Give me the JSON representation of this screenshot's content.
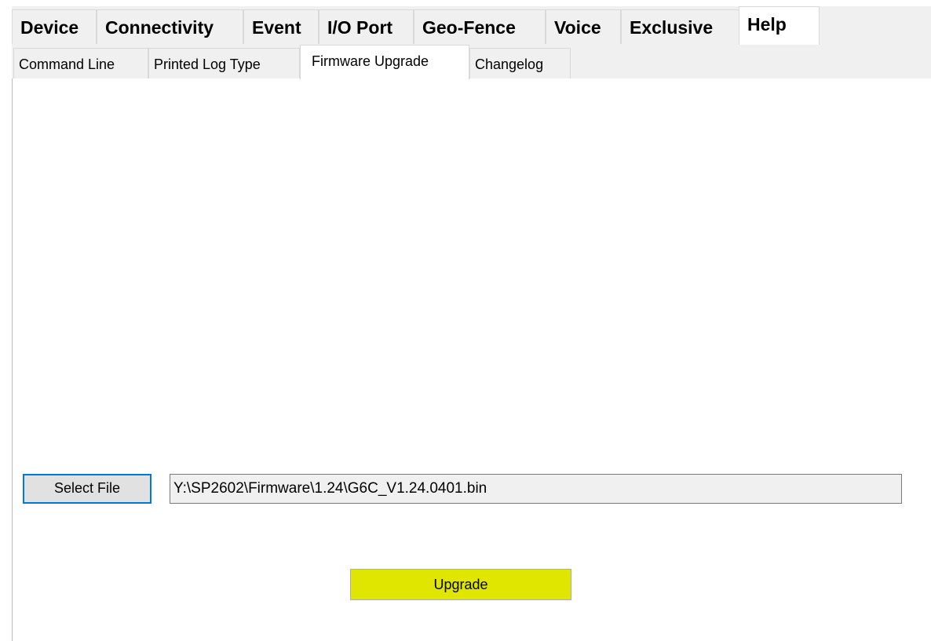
{
  "top_tabs": [
    {
      "label": "Device",
      "active": false
    },
    {
      "label": "Connectivity",
      "active": false
    },
    {
      "label": "Event",
      "active": false
    },
    {
      "label": "I/O Port",
      "active": false
    },
    {
      "label": "Geo-Fence",
      "active": false
    },
    {
      "label": "Voice",
      "active": false
    },
    {
      "label": "Exclusive",
      "active": false
    },
    {
      "label": "Help",
      "active": true
    }
  ],
  "sub_tabs": [
    {
      "label": "Command Line",
      "active": false
    },
    {
      "label": "Printed Log Type",
      "active": false
    },
    {
      "label": "Firmware Upgrade",
      "active": true
    },
    {
      "label": "Changelog",
      "active": false
    }
  ],
  "firmware": {
    "select_file_label": "Select File",
    "file_path": "Y:\\SP2602\\Firmware\\1.24\\G6C_V1.24.0401.bin",
    "upgrade_label": "Upgrade"
  },
  "colors": {
    "upgrade_button": "#e1e600",
    "focus_border": "#0078d7",
    "tab_background": "#f0f0f0"
  }
}
